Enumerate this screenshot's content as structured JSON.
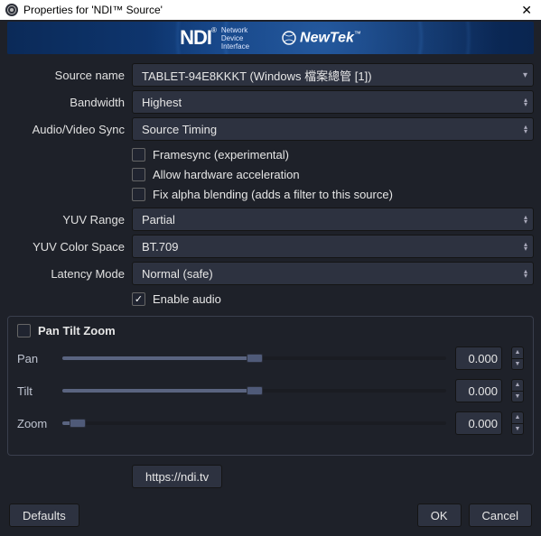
{
  "window": {
    "title": "Properties for 'NDI™ Source'"
  },
  "banner": {
    "ndi_logo": "NDI",
    "ndi_tm": "®",
    "ndi_sub1": "Network",
    "ndi_sub2": "Device",
    "ndi_sub3": "Interface",
    "newtek": "NewTek",
    "newtek_tm": "™"
  },
  "labels": {
    "source_name": "Source name",
    "bandwidth": "Bandwidth",
    "av_sync": "Audio/Video Sync",
    "framesync": "Framesync (experimental)",
    "hw_accel": "Allow hardware acceleration",
    "fix_alpha": "Fix alpha blending (adds a filter to this source)",
    "yuv_range": "YUV Range",
    "yuv_space": "YUV Color Space",
    "latency": "Latency Mode",
    "enable_audio": "Enable audio",
    "ptz": "Pan Tilt Zoom",
    "pan": "Pan",
    "tilt": "Tilt",
    "zoom": "Zoom"
  },
  "values": {
    "source_name": "TABLET-94E8KKKT (Windows 檔案總管 [1])",
    "bandwidth": "Highest",
    "av_sync": "Source Timing",
    "yuv_range": "Partial",
    "yuv_space": "BT.709",
    "latency": "Normal (safe)",
    "pan": "0.000",
    "tilt": "0.000",
    "zoom": "0.000"
  },
  "checks": {
    "framesync": false,
    "hw_accel": false,
    "fix_alpha": false,
    "enable_audio": true,
    "ptz": false
  },
  "sliders": {
    "pan_pct": "50%",
    "tilt_pct": "50%",
    "zoom_pct": "4%"
  },
  "link": "https://ndi.tv",
  "buttons": {
    "defaults": "Defaults",
    "ok": "OK",
    "cancel": "Cancel"
  }
}
